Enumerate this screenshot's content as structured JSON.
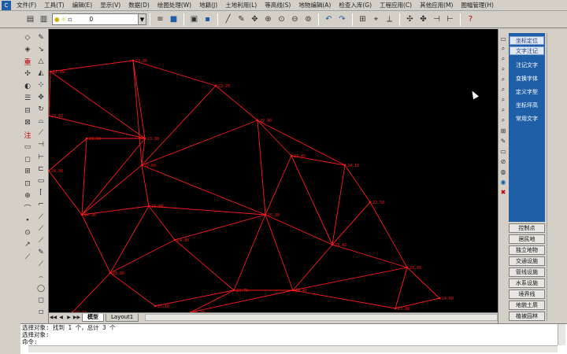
{
  "menubar": {
    "items": [
      "文件(F)",
      "工具(T)",
      "编辑(E)",
      "显示(V)",
      "数据(D)",
      "绘图处理(W)",
      "地籍(J)",
      "土地利用(L)",
      "等高线(S)",
      "地物编辑(A)",
      "检查入库(G)",
      "工程应用(C)",
      "其他应用(M)",
      "图幅管理(H)"
    ]
  },
  "toolbar": {
    "layer_value": "0"
  },
  "tabs": {
    "model": "模型",
    "layout1": "Layout1"
  },
  "right_panel": {
    "top_buttons": [
      "坐标定位",
      "文字注记"
    ],
    "blue_buttons": [
      "注记文字",
      "变换字体",
      "定义字型",
      "坐标坪高",
      "常用文字"
    ],
    "categories": [
      "控制点",
      "居民地",
      "独立地物",
      "交通设施",
      "管线设施",
      "水系设施",
      "境界线",
      "地貌土质",
      "植被园林"
    ]
  },
  "command": {
    "lines": [
      "选择对象: 找到 1 个，总计 3 个",
      "选择对象:",
      "命令:"
    ]
  },
  "colors": {
    "canvas_bg": "#000000",
    "network_line": "#ff1a1a",
    "panel_blue": "#1f5fa8"
  },
  "network": {
    "labels": [
      "22.09",
      "23.00",
      "23.20",
      "23.38",
      "23.50",
      "22.60",
      "22.90",
      "23.45",
      "24.10",
      "24.30",
      "23.80",
      "24.90",
      "25.30",
      "23.42",
      "22.50",
      "23.80",
      "23.70",
      "24.47",
      "23.85",
      "24.60",
      "25.10",
      "23.88",
      "23.92",
      "24.08",
      "23.78",
      "24.33"
    ]
  }
}
